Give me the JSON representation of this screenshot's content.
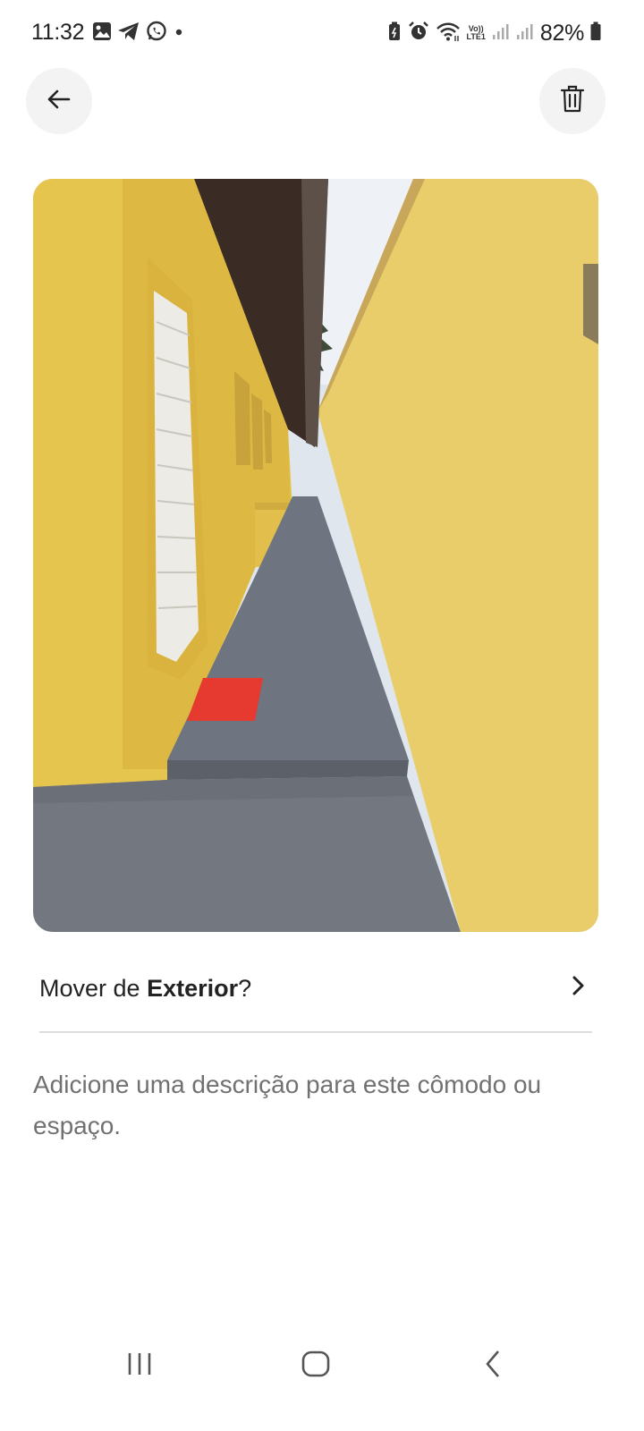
{
  "status_bar": {
    "time": "11:32",
    "left_icons": [
      "gallery-icon",
      "telegram-icon",
      "whatsapp-icon",
      "notification-dot-icon"
    ],
    "right_icons": [
      "battery-saver-icon",
      "alarm-icon",
      "wifi-icon",
      "volte-lte-icon",
      "signal-icon",
      "signal-icon",
      "battery-icon"
    ],
    "volte_top": "Vo))",
    "volte_bottom": "LTE1",
    "battery": "82%"
  },
  "header": {
    "back_icon": "arrow-left-icon",
    "delete_icon": "trash-icon"
  },
  "photo": {
    "subject": "exterior corridor photo",
    "colors": {
      "wall": "#e9cc63",
      "floor": "#737880",
      "roof": "#3a2c24",
      "mat": "#e6392f"
    }
  },
  "move_row": {
    "prefix": "Mover de ",
    "room": "Exterior",
    "suffix": "?",
    "icon": "chevron-right-icon"
  },
  "description": {
    "placeholder": "Adicione uma descrição para este cômodo ou espaço."
  },
  "nav_bar": {
    "items": [
      "recent-apps-icon",
      "home-icon",
      "back-icon"
    ]
  }
}
